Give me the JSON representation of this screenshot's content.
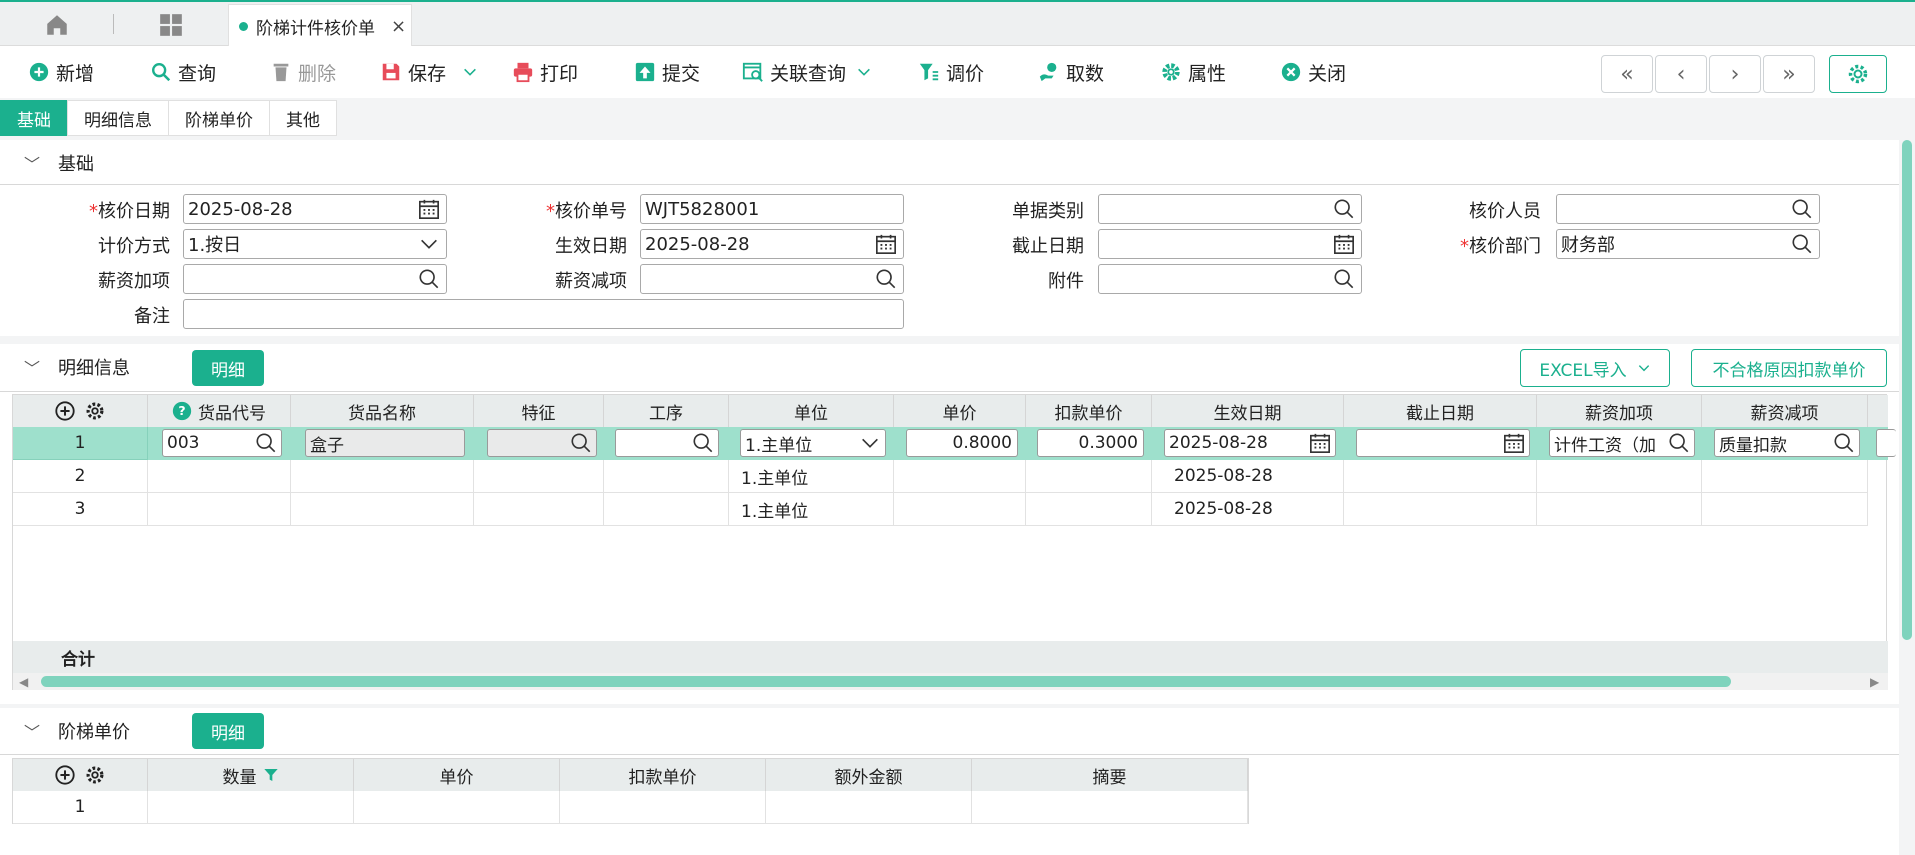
{
  "tabbar": {
    "active_tab": "阶梯计件核价单",
    "close": "×"
  },
  "toolbar": {
    "new": "新增",
    "query": "查询",
    "delete": "删除",
    "save": "保存",
    "print": "打印",
    "submit": "提交",
    "related": "关联查询",
    "adjust": "调价",
    "fetch": "取数",
    "property": "属性",
    "close": "关闭"
  },
  "subtabs": [
    "基础",
    "明细信息",
    "阶梯单价",
    "其他"
  ],
  "basic": {
    "title": "基础",
    "labels": {
      "date": "核价日期",
      "number": "核价单号",
      "doc_type": "单据类别",
      "person": "核价人员",
      "method": "计价方式",
      "effective": "生效日期",
      "deadline": "截止日期",
      "dept": "核价部门",
      "salary_add": "薪资加项",
      "salary_sub": "薪资减项",
      "attachment": "附件",
      "remark": "备注"
    },
    "values": {
      "date": "2025-08-28",
      "number": "WJT5828001",
      "doc_type": "",
      "person": "",
      "method": "1.按日",
      "effective": "2025-08-28",
      "deadline": "",
      "dept": "财务部",
      "salary_add": "",
      "salary_sub": "",
      "attachment": "",
      "remark": ""
    },
    "required_mark": "*"
  },
  "detail": {
    "title": "明细信息",
    "btn": "明细",
    "excel": "EXCEL导入",
    "deduct_btn": "不合格原因扣款单价",
    "columns": [
      "货品代号",
      "货品名称",
      "特征",
      "工序",
      "单位",
      "单价",
      "扣款单价",
      "生效日期",
      "截止日期",
      "薪资加项",
      "薪资减项"
    ],
    "rows": [
      {
        "no": "1",
        "code": "003",
        "name": "盒子",
        "feature": "",
        "process": "",
        "unit": "1.主单位",
        "price": "0.8000",
        "deduct": "0.3000",
        "effective": "2025-08-28",
        "deadline": "",
        "add": "计件工资（加",
        "sub": "质量扣款"
      },
      {
        "no": "2",
        "unit": "1.主单位",
        "effective": "2025-08-28"
      },
      {
        "no": "3",
        "unit": "1.主单位",
        "effective": "2025-08-28"
      }
    ],
    "total_label": "合计"
  },
  "tier": {
    "title": "阶梯单价",
    "btn": "明细",
    "columns": [
      "数量",
      "单价",
      "扣款单价",
      "额外金额",
      "摘要"
    ],
    "rows": [
      {
        "no": "1"
      }
    ]
  }
}
